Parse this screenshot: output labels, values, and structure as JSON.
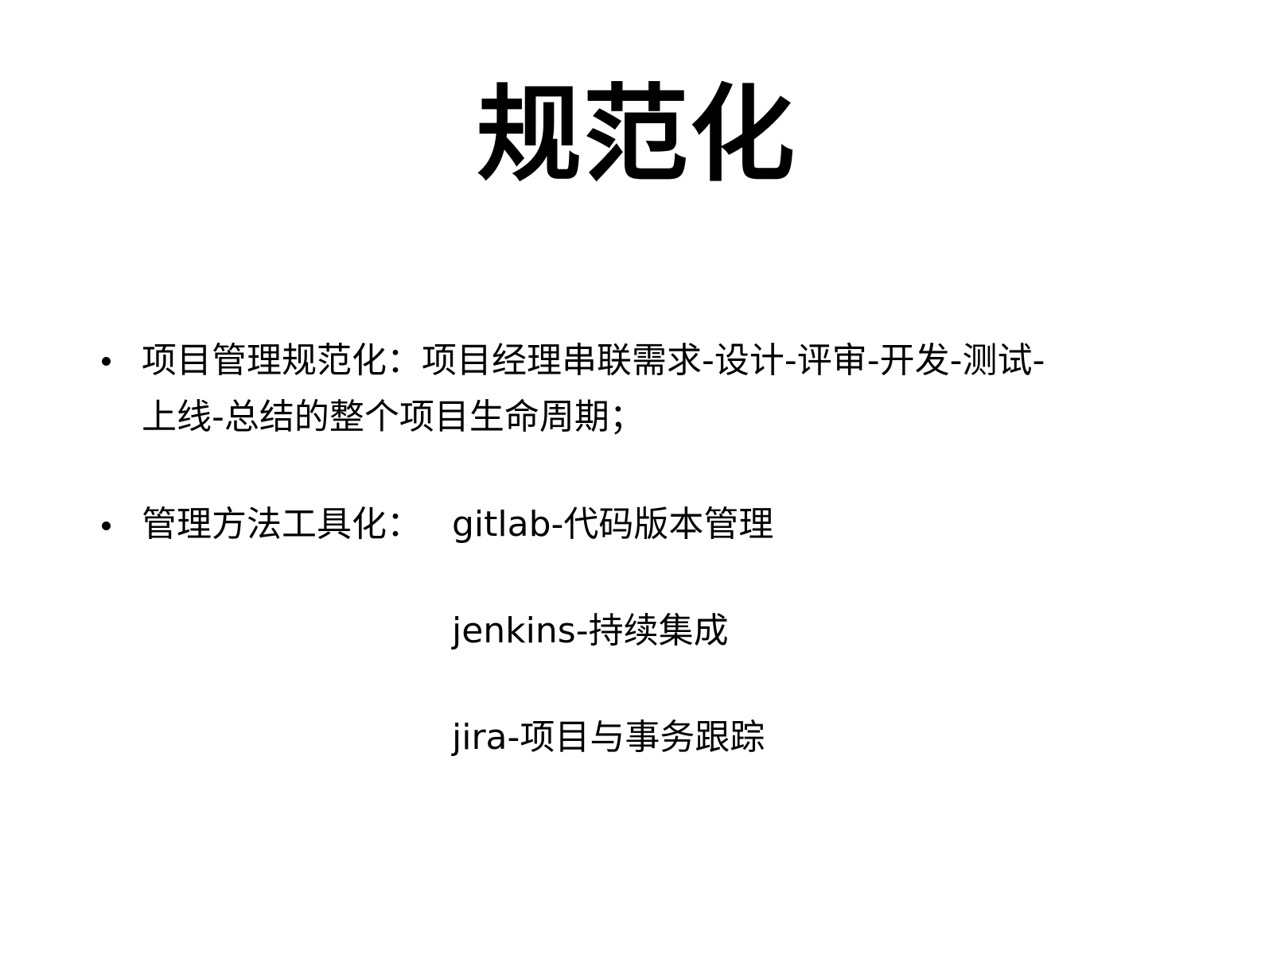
{
  "slide": {
    "title": "规范化",
    "bullets": [
      {
        "lines": [
          "项目管理规范化：项目经理串联需求-设计-评审-开发-测试-",
          "上线-总结的整个项目生命周期；"
        ]
      },
      {
        "label": "管理方法工具化：",
        "tools": [
          "gitlab-代码版本管理",
          "jenkins-持续集成",
          "jira-项目与事务跟踪"
        ]
      }
    ]
  }
}
